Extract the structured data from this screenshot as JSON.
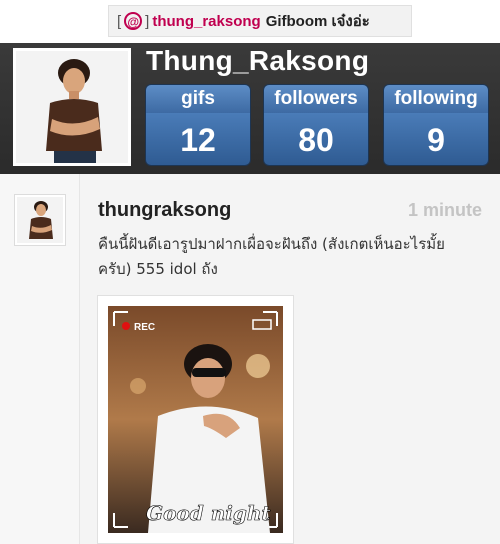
{
  "caption": {
    "open_bracket": "[",
    "at_symbol": "@",
    "close_bracket": "]",
    "username": "thung_raksong",
    "rest": "Gifboom เจ๋งอ่ะ"
  },
  "profile": {
    "display_name": "Thung_Raksong",
    "stats": [
      {
        "label": "gifs",
        "value": "12"
      },
      {
        "label": "followers",
        "value": "80"
      },
      {
        "label": "following",
        "value": "9"
      }
    ]
  },
  "post": {
    "username": "thungraksong",
    "time": "1 minute",
    "text": "คืนนี้ฝันดีเอารูปมาฝากเผื่อจะฝันถึง (สังเกตเห็นอะไรมั้ย ครับ) 555 idol ถัง",
    "gif": {
      "rec_label": "REC",
      "overlay_text": "Good night"
    }
  },
  "colors": {
    "header_bg": "#2f2f2f",
    "stat_blue": "#4a7cb8",
    "username_accent": "#c0004f"
  }
}
